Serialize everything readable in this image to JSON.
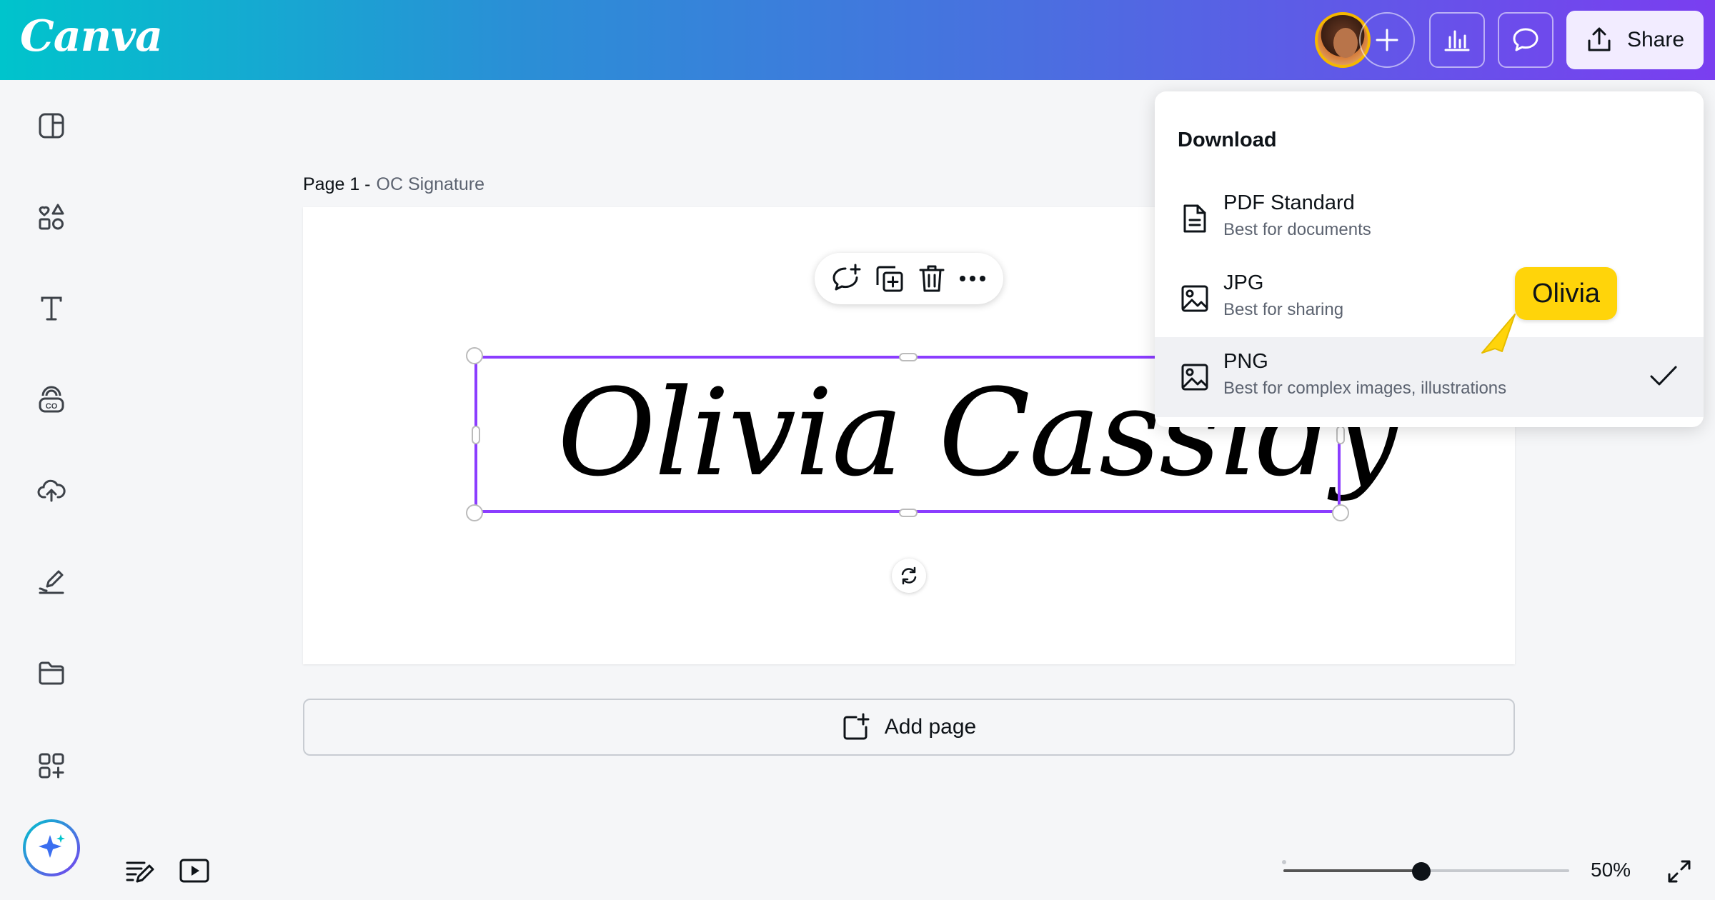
{
  "app": {
    "logo": "Canva"
  },
  "topbar": {
    "share_label": "Share"
  },
  "page": {
    "number": "Page 1 -",
    "name": "OC Signature"
  },
  "canvas": {
    "signature_text": "Olivia Cassidy"
  },
  "add_page_label": "Add page",
  "download": {
    "title": "Download",
    "options": [
      {
        "label": "PDF Standard",
        "sub": "Best for documents",
        "icon": "document-icon",
        "selected": false
      },
      {
        "label": "JPG",
        "sub": "Best for sharing",
        "icon": "image-icon",
        "selected": false
      },
      {
        "label": "PNG",
        "sub": "Best for complex images, illustrations",
        "icon": "image-icon",
        "selected": true
      }
    ]
  },
  "cursor_tag": "Olivia",
  "zoom": {
    "label": "50%",
    "value": 0.5
  },
  "colors": {
    "accent": "#8b3dff",
    "cursor": "#ffd40a"
  }
}
